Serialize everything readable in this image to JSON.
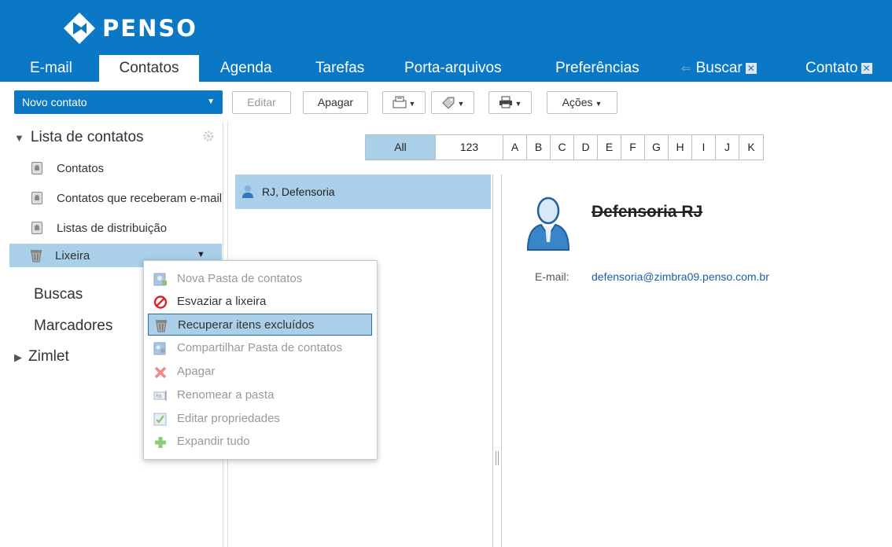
{
  "header": {
    "logo_text": "PENSO",
    "tabs": [
      {
        "label": "E-mail"
      },
      {
        "label": "Contatos"
      },
      {
        "label": "Agenda"
      },
      {
        "label": "Tarefas"
      },
      {
        "label": "Porta-arquivos"
      },
      {
        "label": "Preferências"
      },
      {
        "label": "Buscar"
      },
      {
        "label": "Contato"
      }
    ],
    "close_glyph": "✕"
  },
  "toolbar": {
    "new_contact": "Novo contato",
    "edit": "Editar",
    "delete": "Apagar",
    "actions": "Ações"
  },
  "sidebar": {
    "section_title": "Lista de contatos",
    "folders": [
      {
        "label": "Contatos"
      },
      {
        "label": "Contatos que receberam e-mail"
      },
      {
        "label": "Listas de distribuição"
      },
      {
        "label": "Lixeira"
      }
    ],
    "searches": "Buscas",
    "tags": "Marcadores",
    "zimlet": "Zimlet"
  },
  "alphabet": [
    "All",
    "123",
    "A",
    "B",
    "C",
    "D",
    "E",
    "F",
    "G",
    "H",
    "I",
    "J",
    "K"
  ],
  "list": {
    "items": [
      {
        "label": "RJ, Defensoria"
      }
    ]
  },
  "detail": {
    "name": "Defensoria RJ",
    "email_label": "E-mail:",
    "email": "defensoria@zimbra09.penso.com.br"
  },
  "context_menu": {
    "items": [
      {
        "label": "Nova Pasta de contatos"
      },
      {
        "label": "Esvaziar a lixeira"
      },
      {
        "label": "Recuperar itens excluídos"
      },
      {
        "label": "Compartilhar Pasta de contatos"
      },
      {
        "label": "Apagar"
      },
      {
        "label": "Renomear a pasta"
      },
      {
        "label": "Editar propriedades"
      },
      {
        "label": "Expandir tudo"
      }
    ]
  },
  "colors": {
    "brand": "#0a78c4",
    "selection": "#a9cfe9",
    "link": "#1a5fa8"
  }
}
